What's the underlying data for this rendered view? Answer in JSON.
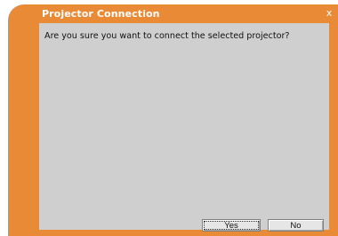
{
  "dialog": {
    "title": "Projector Connection",
    "close_glyph": "x",
    "message": "Are you sure you want to connect the selected projector?",
    "buttons": {
      "yes_label": "Yes",
      "no_label": "No"
    }
  },
  "colors": {
    "frame": "#e98a37",
    "client_background": "#cfcfcf",
    "title_text": "#ffffff"
  }
}
